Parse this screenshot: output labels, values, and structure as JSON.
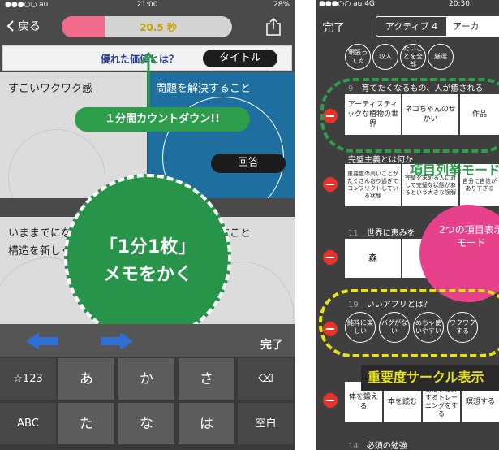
{
  "left": {
    "status": {
      "carrier": "●●●○○ au",
      "time": "21:00",
      "battery": "28%"
    },
    "nav": {
      "back_label": "戻る",
      "timer_text": "20.5 秒",
      "timer_fill_fraction": 0.25
    },
    "title_bar": {
      "question": "優れた価値とは？",
      "pill_label": "タイトル"
    },
    "cells": [
      "すごいワクワク感",
      "問題を解決すること",
      "いままでになかった視点で構造を新しくすること",
      "苦しみをなくすこと"
    ],
    "answer_label": "回答",
    "callout": "１分間カウントダウン!!",
    "big_circle": {
      "line1": "「1分1枚」",
      "line2": "メモをかく"
    },
    "keyboard_bar": {
      "done_label": "完了"
    },
    "keyboard": {
      "row1": [
        "☆123",
        "あ",
        "か",
        "さ",
        "⌫"
      ],
      "row2": [
        "ABC",
        "た",
        "な",
        "は",
        "空白"
      ]
    }
  },
  "right": {
    "status": {
      "carrier": "●●●○○ au 4G",
      "time": "20:30"
    },
    "nav": {
      "done_label": "完了",
      "seg_active": "アクティブ 4",
      "seg_other": "アーカ"
    },
    "row_top": {
      "chips": [
        "頑張ってる",
        "収入",
        "たいことを全部",
        "厳選"
      ]
    },
    "row9": {
      "num": "9",
      "title": "育てたくなるもの、人が癒される",
      "chips": [
        "アーティスティックな植物の世界",
        "ネコちゃんのせかい",
        "作品"
      ]
    },
    "row_between": {
      "title": "完璧主義とは何か",
      "chips": [
        "重要度の高いことがたくさんあり過ぎてコンフリクトしている状態",
        "完璧を求める人に対して完璧な状態があるという大きな誤解",
        "自分に自信がありすぎる"
      ]
    },
    "row11": {
      "num": "11",
      "title": "世界に恵みを",
      "chips": [
        "森",
        "水",
        "空気"
      ]
    },
    "row19": {
      "num": "19",
      "title": "いいアプリとは？",
      "circles": [
        "純粋に楽しい",
        "バグがない",
        "めちゃ使いやすい",
        "ワクワクする"
      ]
    },
    "row_after": {
      "chips": [
        "体を鍛える",
        "本を読む",
        "感情を整理するトレーニングをする",
        "瞑想する"
      ]
    },
    "row14": {
      "num": "14",
      "title": "必須の勉強"
    },
    "labels": {
      "green": "項目列挙モード",
      "pink_line1": "2つの項目表示",
      "pink_line2": "モード",
      "yellow": "重要度サークル表示"
    }
  }
}
